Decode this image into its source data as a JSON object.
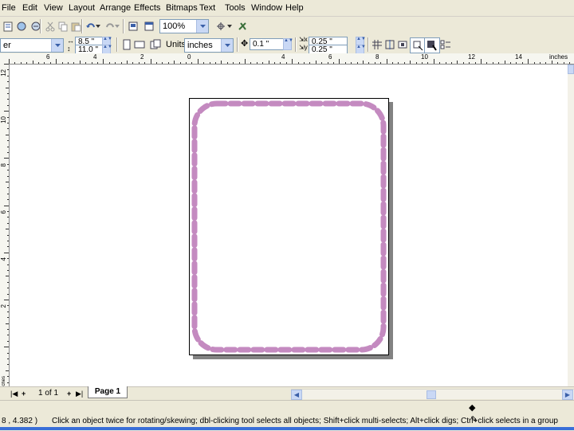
{
  "menu": {
    "items": [
      "File",
      "Edit",
      "View",
      "Layout",
      "Arrange",
      "Effects",
      "Bitmaps",
      "Text",
      "Tools",
      "Window",
      "Help"
    ]
  },
  "toolbar": {
    "zoom_value": "100%"
  },
  "property_bar": {
    "paper_type": "er",
    "width": "8.5 \"",
    "height": "11.0 \"",
    "units_label": "Units:",
    "units_value": "inches",
    "nudge_value": "0.1 \"",
    "dup_x": "0.25 \"",
    "dup_y": "0.25 \""
  },
  "ruler": {
    "h_labels": [
      "6",
      "4",
      "2",
      "0",
      "4",
      "6",
      "8",
      "10",
      "12",
      "14",
      "inches"
    ],
    "v_labels": [
      "12",
      "10",
      "8",
      "6",
      "4",
      "2"
    ],
    "v_unit": "inches"
  },
  "navigator": {
    "page_count": "1 of 1",
    "page_tab": "Page 1"
  },
  "status": {
    "coords": "8 , 4.382 )",
    "message": "Click an object twice for rotating/skewing; dbl-clicking tool selects all objects; Shift+click multi-selects; Alt+click digs; Ctrl+click selects in a group"
  },
  "colors": {
    "border_stroke": "#c48ac0",
    "ui_face": "#ece9d8",
    "accent_blue": "#c9d8f5"
  }
}
